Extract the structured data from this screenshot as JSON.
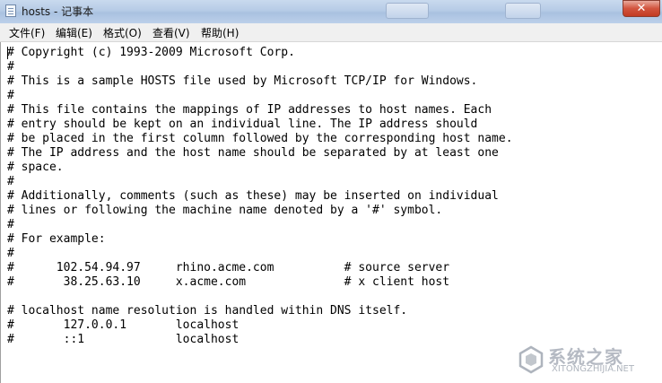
{
  "window": {
    "title": "hosts - 记事本",
    "close_symbol": "✕"
  },
  "menu": {
    "items": [
      {
        "label": "文件(F)"
      },
      {
        "label": "编辑(E)"
      },
      {
        "label": "格式(O)"
      },
      {
        "label": "查看(V)"
      },
      {
        "label": "帮助(H)"
      }
    ]
  },
  "document": {
    "text": "# Copyright (c) 1993-2009 Microsoft Corp.\n#\n# This is a sample HOSTS file used by Microsoft TCP/IP for Windows.\n#\n# This file contains the mappings of IP addresses to host names. Each\n# entry should be kept on an individual line. The IP address should\n# be placed in the first column followed by the corresponding host name.\n# The IP address and the host name should be separated by at least one\n# space.\n#\n# Additionally, comments (such as these) may be inserted on individual\n# lines or following the machine name denoted by a '#' symbol.\n#\n# For example:\n#\n#      102.54.94.97     rhino.acme.com          # source server\n#       38.25.63.10     x.acme.com              # x client host\n\n# localhost name resolution is handled within DNS itself.\n#\t127.0.0.1       localhost\n#\t::1             localhost"
  },
  "watermark": {
    "title": "系统之家",
    "url": "XITONGZHIJIA.NET"
  },
  "icons": {
    "app": "notepad-icon",
    "close": "close-icon",
    "watermark": "xitongzhijia-logo-icon"
  }
}
